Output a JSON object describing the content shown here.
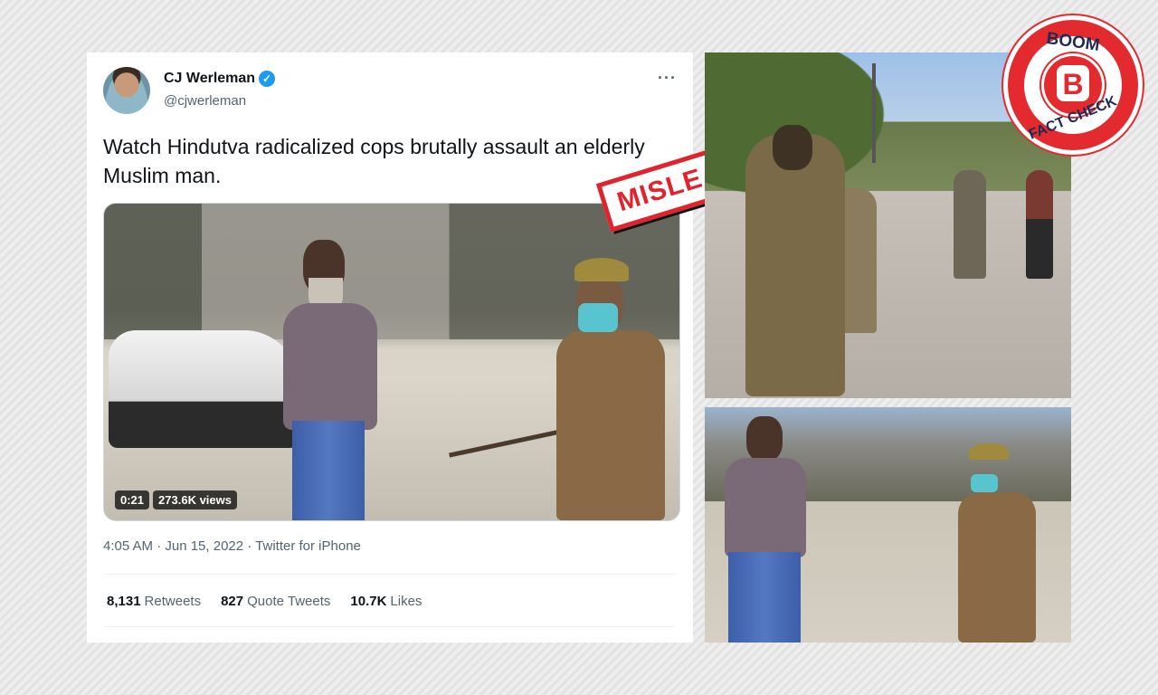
{
  "tweet": {
    "display_name": "CJ Werleman",
    "handle": "@cjwerleman",
    "more_icon": "···",
    "verified_icon": "✓",
    "text": "Watch Hindutva radicalized cops brutally assault an elderly Muslim man.",
    "video": {
      "duration": "0:21",
      "views": "273.6K views"
    },
    "meta": "4:05 AM · Jun 15, 2022 · Twitter for iPhone",
    "stats": {
      "retweets_count": "8,131",
      "retweets_label": "Retweets",
      "quotes_count": "827",
      "quotes_label": "Quote Tweets",
      "likes_count": "10.7K",
      "likes_label": "Likes"
    }
  },
  "stamp": {
    "label": "MISLEADING",
    "color": "#e0242d"
  },
  "badge": {
    "top": "BOOM",
    "letter": "B",
    "bottom": "FACT CHECK",
    "color": "#e32a2f"
  },
  "colors": {
    "verified": "#1d9bf0",
    "text_primary": "#0f1419",
    "text_secondary": "#536471"
  }
}
